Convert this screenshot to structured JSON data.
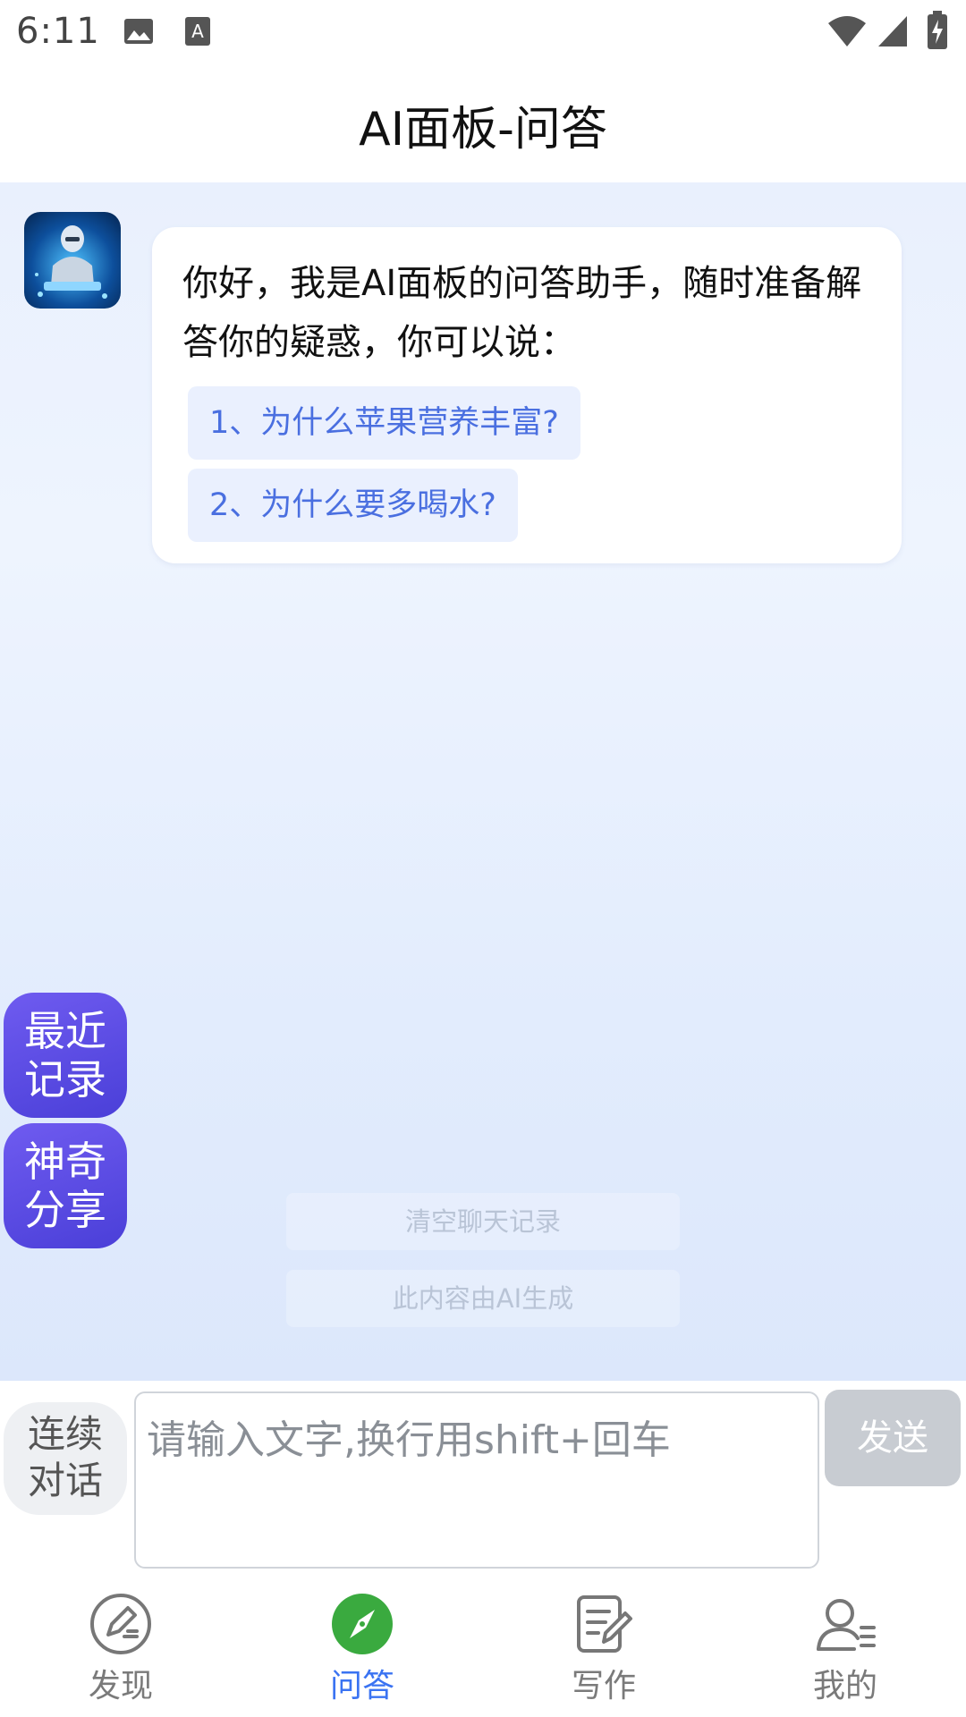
{
  "status_bar": {
    "time": "6:11"
  },
  "header": {
    "title": "AI面板-问答"
  },
  "chat": {
    "greeting": "你好，我是AI面板的问答助手，随时准备解答你的疑惑，你可以说：",
    "suggestions": [
      {
        "label": "1、为什么苹果营养丰富?"
      },
      {
        "label": "2、为什么要多喝水?"
      }
    ]
  },
  "side_buttons": {
    "recent": "最近记录",
    "share": "神奇分享"
  },
  "actions": {
    "clear_history": "清空聊天记录",
    "ai_notice": "此内容由AI生成"
  },
  "input_bar": {
    "continuous_label": "连续对话",
    "placeholder": "请输入文字,换行用shift+回车",
    "send_label": "发送"
  },
  "tabs": [
    {
      "label": "发现",
      "icon": "discover-pen-icon",
      "active": false
    },
    {
      "label": "问答",
      "icon": "compass-icon",
      "active": true
    },
    {
      "label": "写作",
      "icon": "write-edit-icon",
      "active": false
    },
    {
      "label": "我的",
      "icon": "profile-icon",
      "active": false
    }
  ],
  "colors": {
    "accent": "#3a73f2",
    "side_button": "#5a48e4",
    "active_tab_icon": "#3aaa3f",
    "suggestion_text": "#4a6fe0"
  }
}
